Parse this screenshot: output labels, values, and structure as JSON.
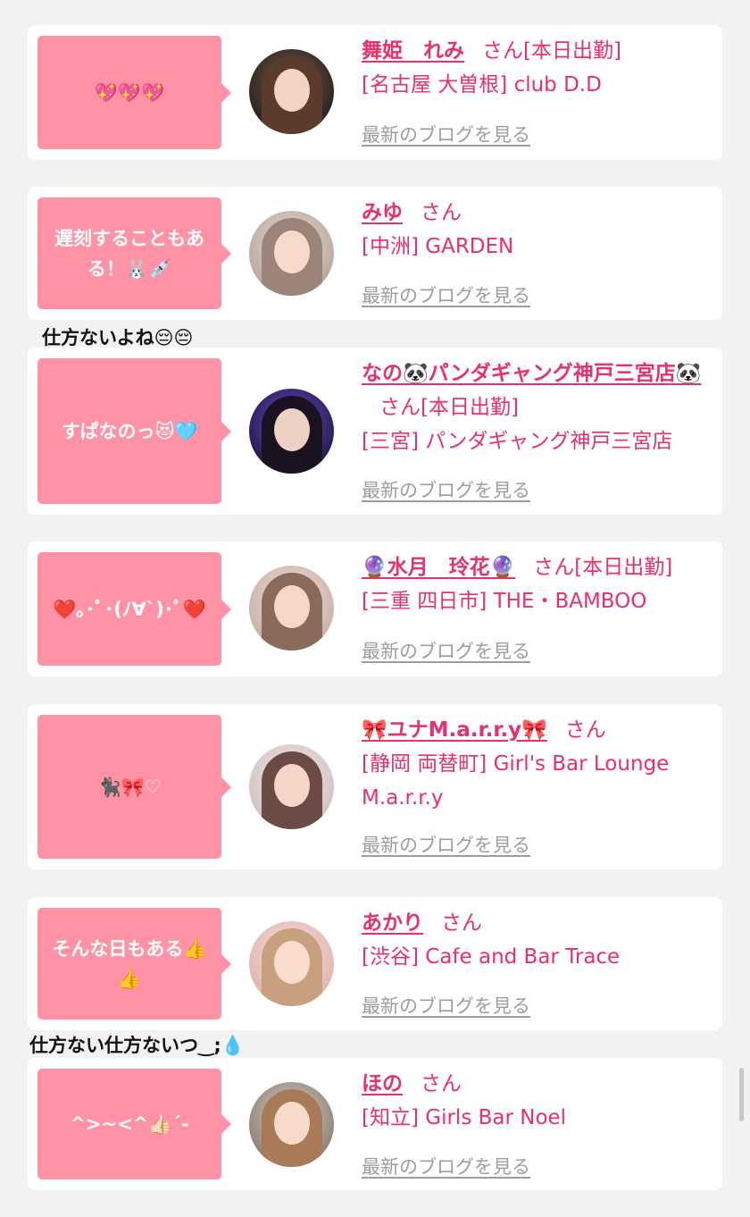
{
  "blog_link_label": "最新のブログを見る",
  "cards": [
    {
      "comment": "💖💖💖",
      "name": "舞姫　れみ",
      "san": "さん",
      "badge": "[本日出勤]",
      "shop": "[名古屋 大曽根] club D.D",
      "blog": "最新のブログを見る"
    },
    {
      "comment": "遅刻することもある！🐰💉",
      "name": "みゆ",
      "san": "さん",
      "badge": "",
      "shop": "[中洲] GARDEN",
      "blog": "最新のブログを見る"
    },
    {
      "comment": "すぱなのっ😻🩵",
      "name": "なの🐼パンダギャング神戸三宮店🐼",
      "san": "さん",
      "badge": "[本日出勤]",
      "shop": "[三宮] パンダギャング神戸三宮店",
      "blog": "最新のブログを見る"
    },
    {
      "comment": "❤️｡･ﾟ･(ﾉ∀`)･ﾟ❤️",
      "name": "🔮水月　玲花🔮",
      "san": "さん",
      "badge": "[本日出勤]",
      "shop": "[三重 四日市] THE・BAMBOO",
      "blog": "最新のブログを見る"
    },
    {
      "comment": "🐈‍⬛🎀♡",
      "name": "🎀ユナM.a.r.r.y🎀",
      "san": "さん",
      "badge": "",
      "shop": "[静岡 両替町] Girl's Bar Lounge M.a.r.r.y",
      "blog": "最新のブログを見る"
    },
    {
      "comment": "そんな日もある👍👍",
      "name": "あかり",
      "san": "さん",
      "badge": "",
      "shop": "[渋谷] Cafe and Bar Trace",
      "blog": "最新のブログを見る"
    },
    {
      "comment": "^>~<^👍🏻´-",
      "name": "ほの",
      "san": "さん",
      "badge": "",
      "shop": "[知立] Girls Bar Noel",
      "blog": "最新のブログを見る"
    }
  ],
  "overflow_notes": [
    "仕方ないよね😔😔",
    "仕方ない仕方ないつ‿;💧"
  ],
  "colors": {
    "page_background": "#f2f2f2",
    "card_background": "#ffffff",
    "bubble": "#ff92a4",
    "name_text": "#e9306a",
    "blog_link": "#9d9d9d"
  }
}
